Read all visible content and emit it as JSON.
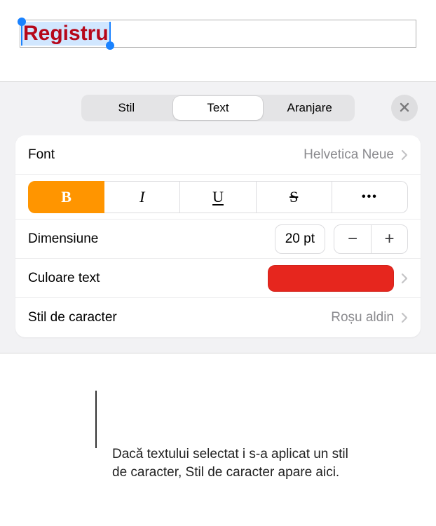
{
  "textbox": {
    "value": "Registru"
  },
  "tabs": {
    "style": "Stil",
    "text": "Text",
    "arrange": "Aranjare"
  },
  "font_row": {
    "label": "Font",
    "value": "Helvetica Neue"
  },
  "style_buttons": {
    "bold": "B",
    "italic": "I",
    "underline": "U",
    "strike": "S",
    "more": "•••"
  },
  "size_row": {
    "label": "Dimensiune",
    "value": "20 pt",
    "minus": "−",
    "plus": "+"
  },
  "color_row": {
    "label": "Culoare text",
    "swatch": "#e6261e"
  },
  "charstyle_row": {
    "label": "Stil de caracter",
    "value": "Roșu aldin"
  },
  "caption": "Dacă textului selectat i s-a aplicat un stil de caracter, Stil de caracter apare aici."
}
